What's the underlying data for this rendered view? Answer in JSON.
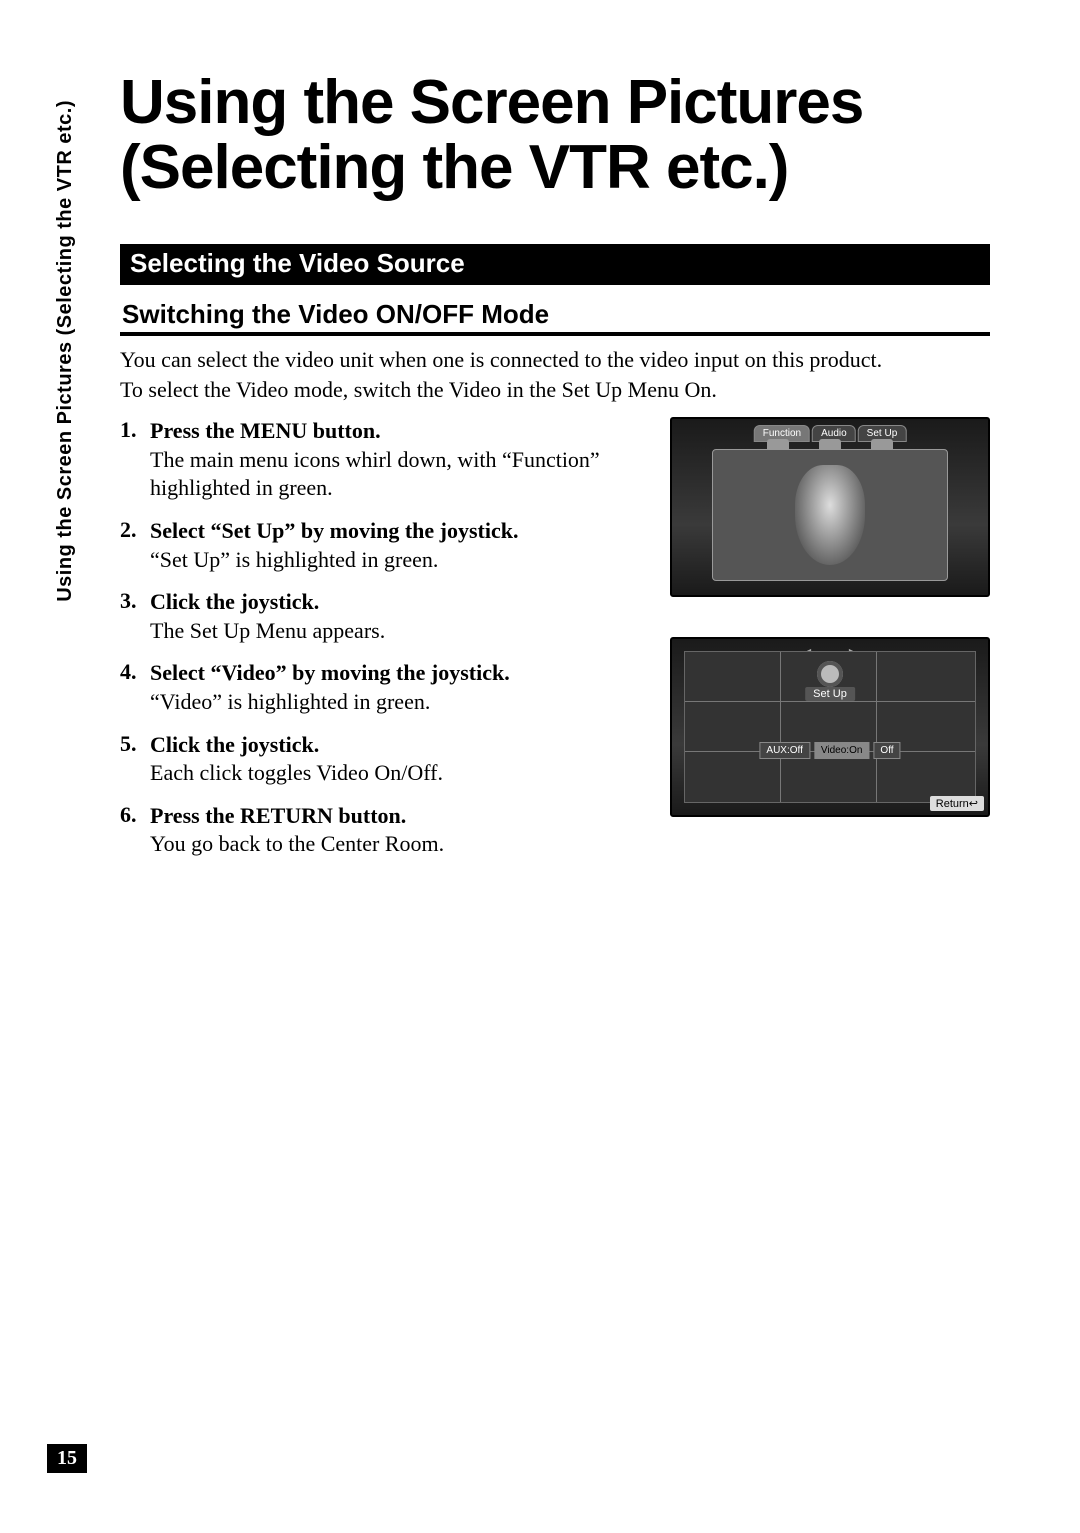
{
  "side_tab": "Using the Screen Pictures (Selecting the VTR etc.)",
  "page_title_line1": "Using the Screen Pictures",
  "page_title_line2": "(Selecting the VTR etc.)",
  "section_title": "Selecting the Video Source",
  "subsection_title": "Switching the Video ON/OFF Mode",
  "intro_line1": "You can select the video unit when one is connected to the video input on this product.",
  "intro_line2": "To select the Video mode, switch the Video in the Set Up Menu On.",
  "steps": [
    {
      "title": "Press the MENU button.",
      "desc": "The main menu icons whirl down, with “Function” highlighted in green."
    },
    {
      "title": "Select “Set Up” by moving the joystick.",
      "desc": "“Set Up” is highlighted in green."
    },
    {
      "title": "Click the joystick.",
      "desc": "The Set Up Menu appears."
    },
    {
      "title": "Select “Video” by moving the joystick.",
      "desc": "“Video” is highlighted in green."
    },
    {
      "title": "Click the joystick.",
      "desc": "Each click toggles Video On/Off."
    },
    {
      "title": "Press the RETURN button.",
      "desc": "You go back to the Center Room."
    }
  ],
  "screen1": {
    "tabs": [
      "Function",
      "Audio",
      "Set Up"
    ]
  },
  "screen2": {
    "setup_label": "Set Up",
    "options": [
      "AUX:Off",
      "Video:On",
      "Off"
    ],
    "return_label": "Return↩"
  },
  "page_number": "15"
}
